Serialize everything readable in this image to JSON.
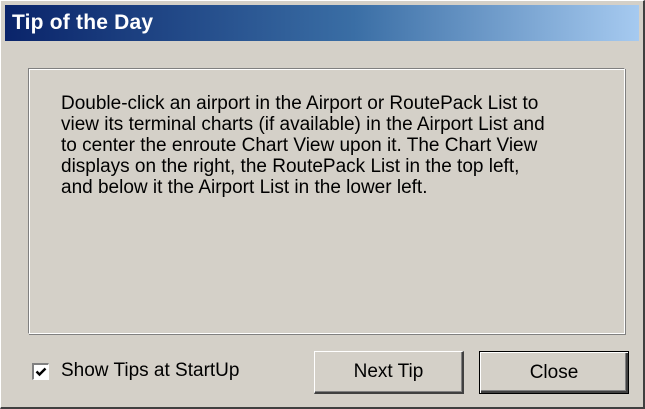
{
  "window": {
    "title": "Tip of the Day"
  },
  "tip": {
    "text": "Double-click an airport in the Airport or RoutePack List to\nview its terminal charts (if available) in the Airport List and\nto center the enroute Chart View upon it.  The Chart View\ndisplays on the right, the RoutePack List in the top left,\nand below it the Airport List in the lower left."
  },
  "options": {
    "show_tips_label": "Show Tips at StartUp",
    "show_tips_checked": true,
    "checkbox_icon": "checkmark-icon"
  },
  "buttons": {
    "next_tip_label": "Next Tip",
    "close_label": "Close"
  },
  "colors": {
    "dialog_face": "#d4d0c8",
    "titlebar_start": "#0a246a",
    "titlebar_end": "#a6caf0",
    "title_text": "#ffffff"
  }
}
